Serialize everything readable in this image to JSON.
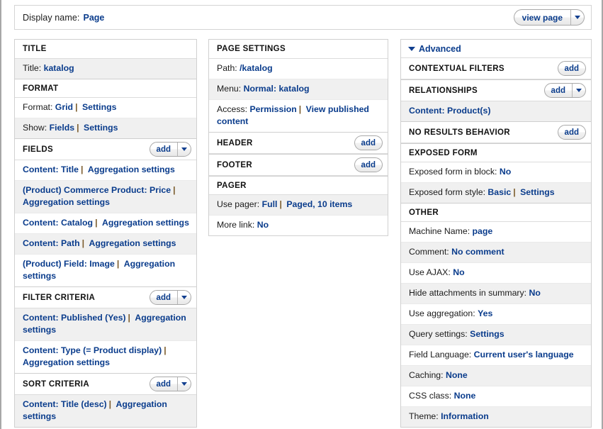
{
  "header": {
    "display_name_label": "Display name:",
    "display_name_value": "Page",
    "view_page_button": "view page",
    "caret_icon": "chevron-down-icon"
  },
  "buttons": {
    "add": "add"
  },
  "left_column": {
    "sections": [
      {
        "title": "TITLE",
        "has_add": false,
        "rows": [
          {
            "label": "Title:",
            "links": [
              "katalog"
            ],
            "alt": true
          }
        ]
      },
      {
        "title": "FORMAT",
        "has_add": false,
        "rows": [
          {
            "label": "Format:",
            "links": [
              "Grid",
              "Settings"
            ],
            "alt": false
          },
          {
            "label": "Show:",
            "links": [
              "Fields",
              "Settings"
            ],
            "alt": true
          }
        ]
      },
      {
        "title": "FIELDS",
        "has_add": true,
        "has_caret": true,
        "rows": [
          {
            "label": "",
            "links": [
              "Content: Title",
              "Aggregation settings"
            ],
            "alt": false
          },
          {
            "label": "",
            "links": [
              "(Product) Commerce Product: Price",
              "Aggregation settings"
            ],
            "alt": true
          },
          {
            "label": "",
            "links": [
              "Content: Catalog",
              "Aggregation settings"
            ],
            "alt": false
          },
          {
            "label": "",
            "links": [
              "Content: Path",
              "Aggregation settings"
            ],
            "alt": true
          },
          {
            "label": "",
            "links": [
              "(Product) Field: Image",
              "Aggregation settings"
            ],
            "alt": false
          }
        ]
      },
      {
        "title": "FILTER CRITERIA",
        "has_add": true,
        "has_caret": true,
        "rows": [
          {
            "label": "",
            "links": [
              "Content: Published (Yes)",
              "Aggregation settings"
            ],
            "alt": true
          },
          {
            "label": "",
            "links": [
              "Content: Type (= Product display)",
              "Aggregation settings"
            ],
            "alt": false
          }
        ]
      },
      {
        "title": "SORT CRITERIA",
        "has_add": true,
        "has_caret": true,
        "rows": [
          {
            "label": "",
            "links": [
              "Content: Title (desc)",
              "Aggregation settings"
            ],
            "alt": true
          }
        ]
      }
    ]
  },
  "middle_column": {
    "sections": [
      {
        "title": "PAGE SETTINGS",
        "has_add": false,
        "rows": [
          {
            "label": "Path:",
            "links": [
              "/katalog"
            ],
            "alt": false
          },
          {
            "label": "Menu:",
            "links": [
              "Normal: katalog"
            ],
            "alt": true
          },
          {
            "label": "Access:",
            "links": [
              "Permission",
              "View published content"
            ],
            "alt": false
          }
        ]
      },
      {
        "title": "HEADER",
        "has_add": true,
        "has_caret": false,
        "rows": []
      },
      {
        "title": "FOOTER",
        "has_add": true,
        "has_caret": false,
        "rows": []
      },
      {
        "title": "PAGER",
        "has_add": false,
        "rows": [
          {
            "label": "Use pager:",
            "links": [
              "Full",
              "Paged, 10 items"
            ],
            "alt": true
          },
          {
            "label": "More link:",
            "links": [
              "No"
            ],
            "alt": false
          }
        ]
      }
    ]
  },
  "right_column": {
    "advanced_label": "Advanced",
    "advanced_icon": "triangle-down-icon",
    "sections": [
      {
        "title": "CONTEXTUAL FILTERS",
        "has_add": true,
        "has_caret": false,
        "rows": []
      },
      {
        "title": "RELATIONSHIPS",
        "has_add": true,
        "has_caret": true,
        "rows": [
          {
            "label": "",
            "links": [
              "Content: Product(s)"
            ],
            "alt": true
          }
        ]
      },
      {
        "title": "NO RESULTS BEHAVIOR",
        "has_add": true,
        "has_caret": false,
        "rows": []
      },
      {
        "title": "EXPOSED FORM",
        "has_add": false,
        "rows": [
          {
            "label": "Exposed form in block:",
            "links": [
              "No"
            ],
            "alt": false
          },
          {
            "label": "Exposed form style:",
            "links": [
              "Basic",
              "Settings"
            ],
            "alt": true
          }
        ]
      },
      {
        "title": "OTHER",
        "has_add": false,
        "rows": [
          {
            "label": "Machine Name:",
            "links": [
              "page"
            ],
            "alt": false
          },
          {
            "label": "Comment:",
            "links": [
              "No comment"
            ],
            "alt": true
          },
          {
            "label": "Use AJAX:",
            "links": [
              "No"
            ],
            "alt": false
          },
          {
            "label": "Hide attachments in summary:",
            "links": [
              "No"
            ],
            "alt": true
          },
          {
            "label": "Use aggregation:",
            "links": [
              "Yes"
            ],
            "alt": false
          },
          {
            "label": "Query settings:",
            "links": [
              "Settings"
            ],
            "alt": true
          },
          {
            "label": "Field Language:",
            "links": [
              "Current user's language"
            ],
            "alt": false
          },
          {
            "label": "Caching:",
            "links": [
              "None"
            ],
            "alt": true
          },
          {
            "label": "CSS class:",
            "links": [
              "None"
            ],
            "alt": false
          },
          {
            "label": "Theme:",
            "links": [
              "Information"
            ],
            "alt": true
          }
        ]
      }
    ]
  }
}
